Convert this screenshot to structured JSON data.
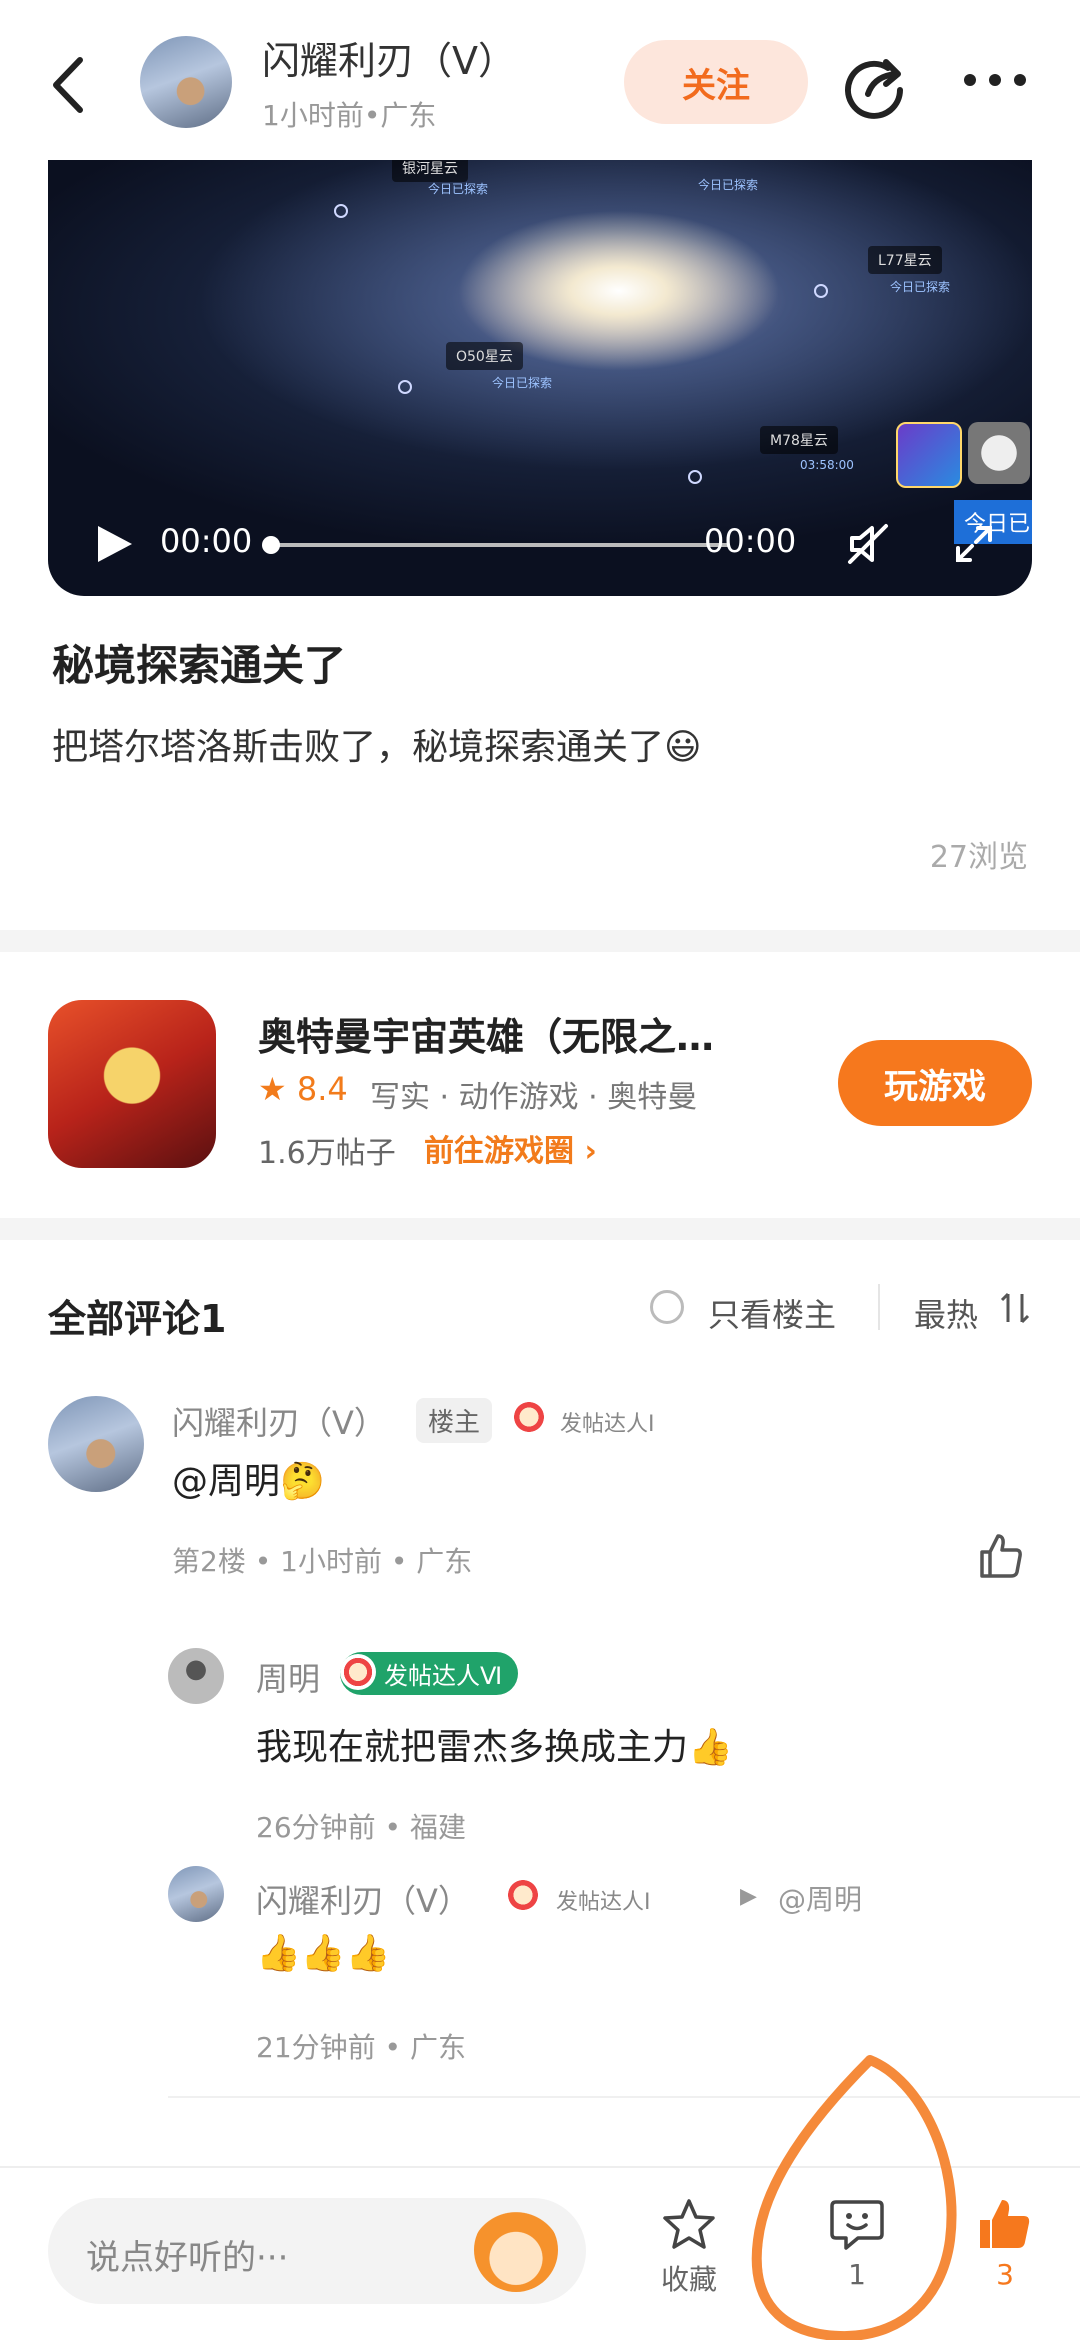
{
  "header": {
    "author_name": "闪耀利刃（V）",
    "author_meta": "1小时前•广东",
    "follow_label": "关注"
  },
  "video": {
    "current_time": "00:00",
    "duration": "00:00",
    "progress": 0,
    "stars": [
      {
        "name": "银河星云",
        "sub": "今日已探索"
      },
      {
        "name": "",
        "sub": "今日已探索"
      },
      {
        "name": "L77星云",
        "sub": "今日已探索"
      },
      {
        "name": "O50星云",
        "sub": "今日已探索"
      },
      {
        "name": "M78星云",
        "sub": "03:58:00"
      }
    ],
    "corner_label": "今日已"
  },
  "post": {
    "title": "秘境探索通关了",
    "body": "把塔尔塔洛斯击败了，秘境探索通关了😃",
    "views": "27浏览"
  },
  "game": {
    "title": "奥特曼宇宙英雄（无限之…",
    "rating": "8.4",
    "tags": "写实 · 动作游戏 · 奥特曼",
    "posts": "1.6万帖子",
    "circle_link": "前往游戏圈",
    "play_label": "玩游戏"
  },
  "comments": {
    "title": "全部评论1",
    "op_only_label": "只看楼主",
    "sort_label": "最热",
    "main": {
      "name": "闪耀利刃（V）",
      "host_badge": "楼主",
      "level_badge": "发帖达人Ⅰ",
      "text": "@周明🤔",
      "meta": "第2楼 • 1小时前 • 广东"
    },
    "replies": [
      {
        "name": "周明",
        "level_badge": "发帖达人Ⅵ",
        "text": "我现在就把雷杰多换成主力👍",
        "meta": "26分钟前 • 福建"
      },
      {
        "name": "闪耀利刃（V）",
        "level_badge": "发帖达人Ⅰ",
        "reply_to": "@周明",
        "text": "👍👍👍",
        "meta": "21分钟前 • 广东"
      }
    ]
  },
  "bottombar": {
    "placeholder": "说点好听的···",
    "favorite_label": "收藏",
    "comment_count": "1",
    "like_count": "3"
  },
  "colors": {
    "accent": "#f6781d",
    "follow_bg": "#fde6dc",
    "badge_green": "#20a36a",
    "annotation": "#f58a3a"
  }
}
